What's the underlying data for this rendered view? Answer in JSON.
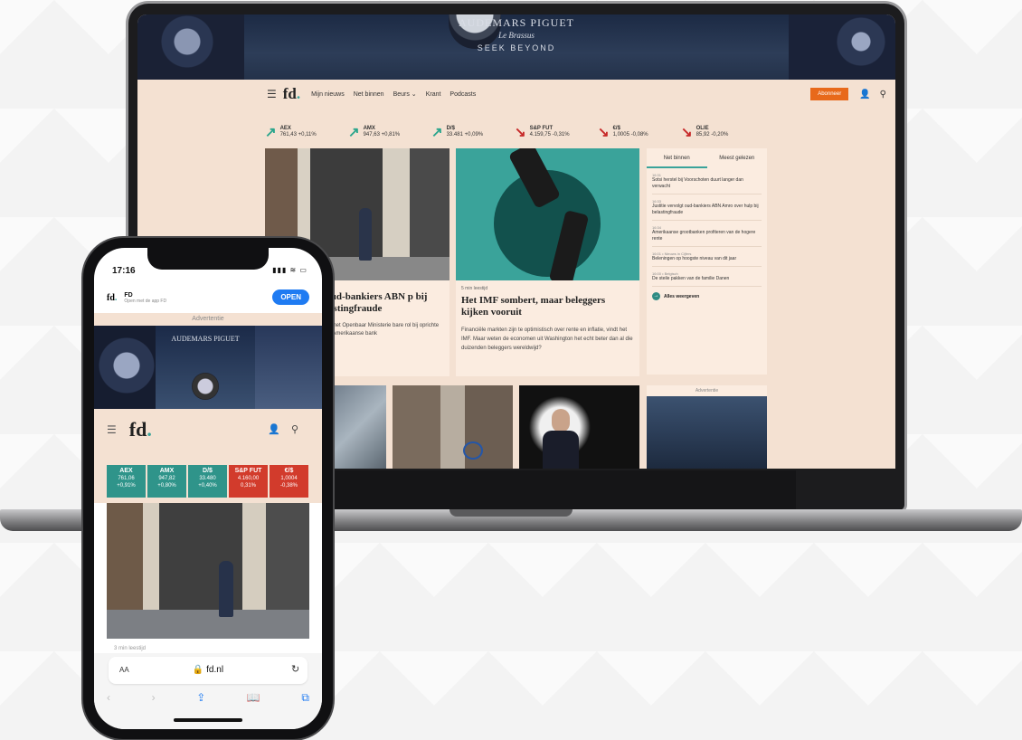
{
  "laptop": {
    "ad": {
      "brand": "AUDEMARS PIGUET",
      "subtitle": "Le Brassus",
      "tagline": "SEEK BEYOND"
    },
    "header": {
      "logo": "fd",
      "logo_dot": ".",
      "nav": [
        "Mijn nieuws",
        "Net binnen",
        "Beurs ⌄",
        "Krant",
        "Podcasts"
      ],
      "subscribe": "Abonneer"
    },
    "tickers": [
      {
        "name": "AEX",
        "value": "761,43",
        "change": "+0,11%",
        "dir": "up"
      },
      {
        "name": "AMX",
        "value": "947,63",
        "change": "+0,81%",
        "dir": "up"
      },
      {
        "name": "D/$",
        "value": "33.481",
        "change": "+0,09%",
        "dir": "up"
      },
      {
        "name": "S&P FUT",
        "value": "4.159,75",
        "change": "-0,31%",
        "dir": "down"
      },
      {
        "name": "€/$",
        "value": "1,0005",
        "change": "-0,08%",
        "dir": "down"
      },
      {
        "name": "OLIE",
        "value": "85,92",
        "change": "-0,20%",
        "dir": "down"
      }
    ],
    "article1": {
      "title": "rt oud-bankiers ABN p bij belastingfraude",
      "body": "olgens het Openbaar Ministerie bare rol bij oprichte oor de Amerikaanse bank"
    },
    "article2": {
      "meta": "5 min leestijd",
      "title": "Het IMF sombert, maar beleggers kijken vooruit",
      "body": "Financiële markten zijn te optimistisch over rente en inflatie, vindt het IMF. Maar weten de economen uit Washington het echt beter dan al die duizenden beleggers wereldwijd?"
    },
    "sidebar": {
      "tabs": [
        "Net binnen",
        "Meest gelezen"
      ],
      "items": [
        {
          "time": "16:31",
          "text": "Sotsi herstel bij Voorschoten duurt langer dan verwacht"
        },
        {
          "time": "16:33",
          "text": "Justitie vervolgt oud-bankiers ABN Amro over hulp bij belastingfraude"
        },
        {
          "time": "16:34",
          "text": "Amerikaanse grootbanken profiteren van de hogere rente"
        },
        {
          "time": "16:01 • Nieuws in Cijfers",
          "text": "Beleningen op hoogste niveau van dit jaar"
        },
        {
          "time": "16:00 • Belgisch",
          "text": "De steile pakken van de familie Danen"
        }
      ],
      "more": "Alles weergeven"
    },
    "ad2_label": "Advertentie"
  },
  "phone": {
    "time": "17:16",
    "status_icons": "▮▮▮ ≋ ▭",
    "smart_banner": {
      "logo": "fd",
      "name": "FD",
      "desc": "Open met de app FD",
      "open": "OPEN"
    },
    "ad_label": "Advertentie",
    "ad_brand": "AUDEMARS PIGUET",
    "logo": "fd",
    "logo_dot": ".",
    "tickers": [
      {
        "name": "AEX",
        "value": "761,06",
        "change": "+0,91%",
        "dir": "up"
      },
      {
        "name": "AMX",
        "value": "947,82",
        "change": "+0,80%",
        "dir": "up"
      },
      {
        "name": "D/$",
        "value": "33.480",
        "change": "+0,40%",
        "dir": "up"
      },
      {
        "name": "S&P FUT",
        "value": "4.160,00",
        "change": "0,31%",
        "dir": "down"
      },
      {
        "name": "€/$",
        "value": "1,0004",
        "change": "-0,38%",
        "dir": "down"
      }
    ],
    "article_meta": "3 min leestijd",
    "url_aa": "AA",
    "url": "🔒 fd.nl",
    "reload": "↻",
    "toolbar": [
      "‹",
      "›",
      "⇪",
      "📖",
      "⧉"
    ]
  }
}
